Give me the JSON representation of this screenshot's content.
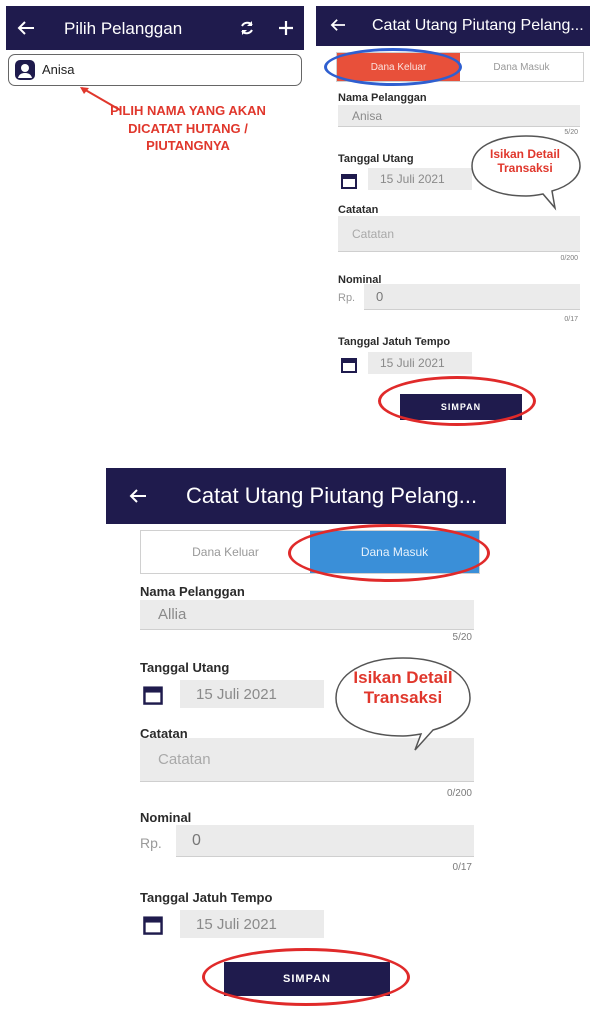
{
  "panel_select": {
    "header": {
      "title": "Pilih Pelanggan",
      "back_icon": "arrow-left-icon",
      "refresh_icon": "refresh-icon",
      "add_icon": "plus-icon"
    },
    "customer_item": {
      "name": "Anisa",
      "icon": "person-icon"
    },
    "annotation": {
      "text": "PILIH NAMA YANG AKAN DICATAT HUTANG / PIUTANGNYA",
      "line1": "PILIH NAMA YANG AKAN",
      "line2": "DICATAT HUTANG /",
      "line3": "PIUTANGNYA",
      "color": "#e0372c"
    }
  },
  "panel_keluar": {
    "header": {
      "title": "Catat Utang Piutang Pelang..."
    },
    "tabs": [
      {
        "label": "Dana Keluar",
        "active": true
      },
      {
        "label": "Dana Masuk",
        "active": false
      }
    ],
    "nama_label": "Nama Pelanggan",
    "nama_value": "Anisa",
    "nama_counter": "5/20",
    "tanggal_label": "Tanggal Utang",
    "tanggal_value": "15 Juli 2021",
    "catatan_label": "Catatan",
    "catatan_placeholder": "Catatan",
    "catatan_counter": "0/200",
    "nominal_label": "Nominal",
    "nominal_prefix": "Rp.",
    "nominal_value": "0",
    "nominal_counter": "0/17",
    "jatuh_tempo_label": "Tanggal Jatuh Tempo",
    "jatuh_tempo_value": "15 Juli 2021",
    "save_label": "SIMPAN",
    "bubble_line1": "Isikan Detail",
    "bubble_line2": "Transaksi"
  },
  "panel_masuk": {
    "header": {
      "title": "Catat Utang Piutang Pelang..."
    },
    "tabs": [
      {
        "label": "Dana Keluar",
        "active": false
      },
      {
        "label": "Dana Masuk",
        "active": true
      }
    ],
    "nama_label": "Nama Pelanggan",
    "nama_value": "Allia",
    "nama_counter": "5/20",
    "tanggal_label": "Tanggal Utang",
    "tanggal_value": "15 Juli 2021",
    "catatan_label": "Catatan",
    "catatan_placeholder": "Catatan",
    "catatan_counter": "0/200",
    "nominal_label": "Nominal",
    "nominal_prefix": "Rp.",
    "nominal_value": "0",
    "nominal_counter": "0/17",
    "jatuh_tempo_label": "Tanggal Jatuh Tempo",
    "jatuh_tempo_value": "15 Juli 2021",
    "save_label": "SIMPAN",
    "bubble_line1": "Isikan Detail",
    "bubble_line2": "Transaksi"
  },
  "colors": {
    "header": "#1f1b4d",
    "accent_red": "#e0372c",
    "tab_keluar_active": "#e8503a",
    "tab_masuk_active": "#3a8fd8"
  }
}
